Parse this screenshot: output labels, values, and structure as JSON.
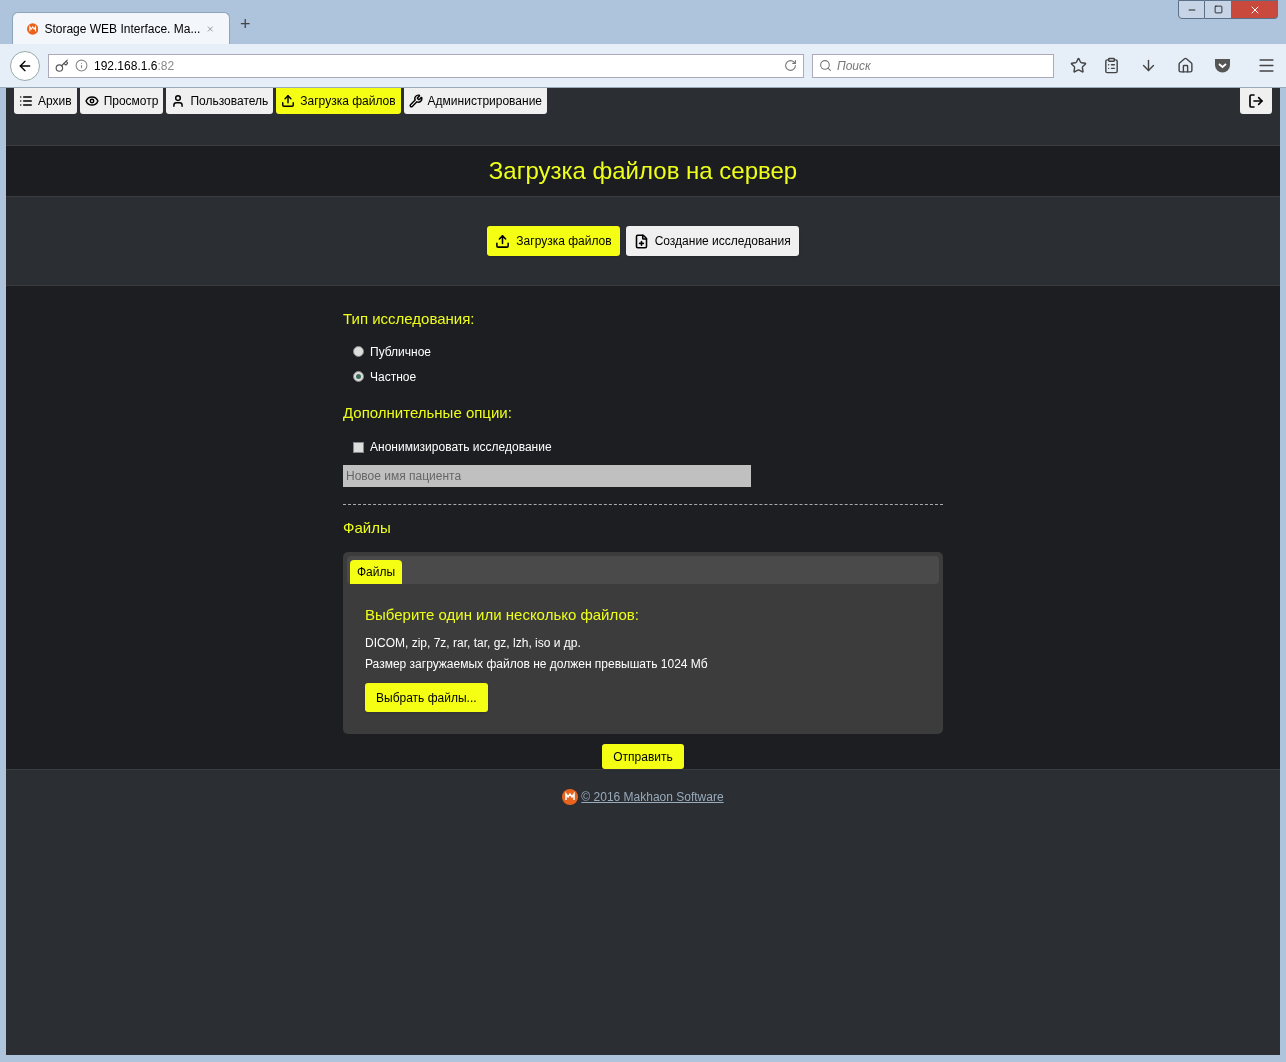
{
  "browser": {
    "tab_title": "Storage WEB Interface. Ma...",
    "url_host": "192.168.1.6",
    "url_port": ":82",
    "search_placeholder": "Поиск",
    "new_tab": "+"
  },
  "nav": [
    {
      "label": "Архив",
      "selected": false
    },
    {
      "label": "Просмотр",
      "selected": false
    },
    {
      "label": "Пользователь",
      "selected": false
    },
    {
      "label": "Загрузка файлов",
      "selected": true
    },
    {
      "label": "Администрирование",
      "selected": false
    }
  ],
  "page_title": "Загрузка файлов на сервер",
  "mode_buttons": [
    {
      "label": "Загрузка файлов",
      "selected": true
    },
    {
      "label": "Создание исследования",
      "selected": false
    }
  ],
  "study_type": {
    "heading": "Тип исследования:",
    "options": [
      {
        "label": "Публичное",
        "selected": false
      },
      {
        "label": "Частное",
        "selected": true
      }
    ]
  },
  "options": {
    "heading": "Дополнительные опции:",
    "anonymize": {
      "label": "Анонимизировать исследование",
      "checked": false
    },
    "patient_name_placeholder": "Новое имя пациента"
  },
  "files": {
    "heading": "Файлы",
    "tabs": [
      {
        "label": "Файлы",
        "selected": true
      }
    ],
    "prompt": "Выберите один или несколько файлов:",
    "formats": "DICOM, zip, 7z, rar, tar, gz, lzh, iso и др.",
    "size_note": "Размер загружаемых файлов не должен превышать 1024 Мб",
    "choose_button": "Выбрать файлы..."
  },
  "submit": "Отправить",
  "footer": "© 2016 Makhaon Software"
}
